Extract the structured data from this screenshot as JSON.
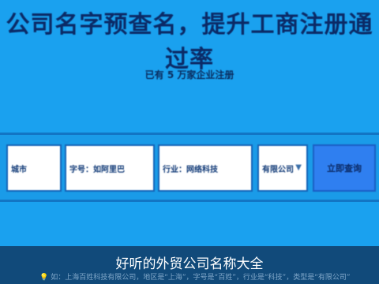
{
  "banner": {
    "headline": "公司名字预查名，提升工商注册通过率",
    "subline": "已有 5 万家企业注册"
  },
  "form": {
    "field1": "城市",
    "field2": "字号：如阿里巴",
    "field3": "行业：网络科技",
    "field4": "有限公司",
    "select_arrow": "▼",
    "submit_label": "立即查询"
  },
  "caption": {
    "title": "好听的外贸公司名称大全",
    "note_icon": "lightbulb-icon",
    "note_glyph": "💡",
    "note": "如：上海百姓科技有限公司，地区是“上海”，字号是“百姓”，行业是“科技”，类型是“有限公司”"
  }
}
